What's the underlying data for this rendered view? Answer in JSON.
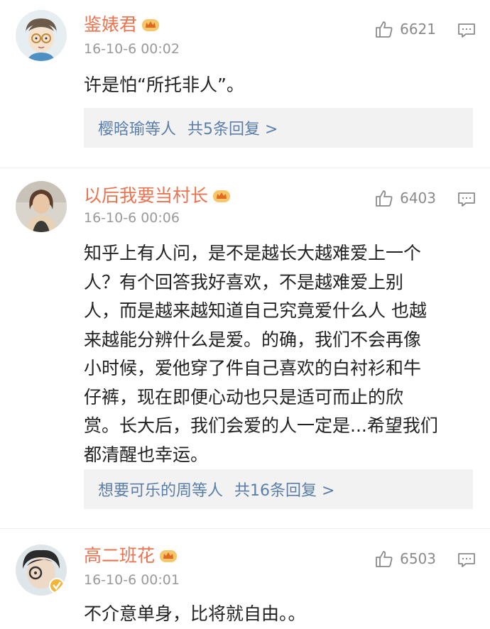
{
  "comments": [
    {
      "username": "鉴婊君",
      "time": "16-10-6 00:02",
      "likes": "6621",
      "text": [
        "许是怕“所托非人”。"
      ],
      "replies_users": "樱晗瑜等人",
      "replies_count": "共5条回复 >",
      "avatar_icon": "cartoon-boy-avatar"
    },
    {
      "username": "以后我要当村长",
      "time": "16-10-6 00:06",
      "likes": "6403",
      "text": [
        "知乎上有人问，是不是越长大越难爱上一个",
        "人？有个回答我好喜欢，不是越难爱上别",
        "人，而是越来越知道自己究竟爱什么人 也越",
        "来越能分辨什么是爱。的确，我们不会再像",
        "小时候，爱他穿了件自己喜欢的白衬衫和牛",
        "仔裤，现在即便心动也只是适可而止的欣",
        "赏。长大后，我们会爱的人一定是...希望我们",
        "都清醒也幸运。"
      ],
      "replies_users": "想要可乐的周等人",
      "replies_count": "共16条回复 >",
      "avatar_icon": "girl-photo-avatar"
    },
    {
      "username": "高二班花",
      "time": "16-10-6 00:01",
      "likes": "6503",
      "text": [
        "不介意单身，比将就自由。。"
      ],
      "avatar_icon": "boy-photo-avatar"
    }
  ],
  "colors": {
    "username": "#eb7350",
    "link": "#5a7ea8",
    "meta": "#9a9a9a",
    "reply_bg": "#f2f2f2"
  }
}
